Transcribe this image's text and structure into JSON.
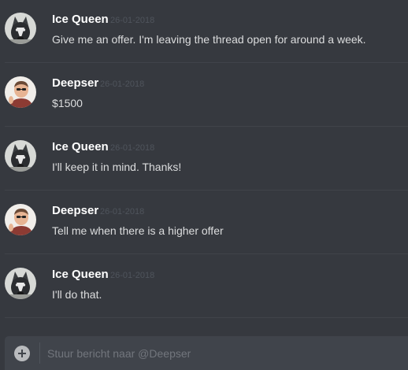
{
  "messages": [
    {
      "author": "Ice Queen",
      "timestamp": "26-01-2018",
      "text": "Give me an offer. I'm leaving the thread open for around a week.",
      "avatar": "husky-avatar"
    },
    {
      "author": "Deepser",
      "timestamp": "26-01-2018",
      "text": "$1500",
      "avatar": "person-avatar"
    },
    {
      "author": "Ice Queen",
      "timestamp": "26-01-2018",
      "text": "I'll keep it in mind. Thanks!",
      "avatar": "husky-avatar"
    },
    {
      "author": "Deepser",
      "timestamp": "26-01-2018",
      "text": "Tell me when there is a higher offer",
      "avatar": "person-avatar"
    },
    {
      "author": "Ice Queen",
      "timestamp": "26-01-2018",
      "text": "I'll do that.",
      "avatar": "husky-avatar"
    }
  ],
  "composer": {
    "placeholder": "Stuur bericht naar @Deepser",
    "value": ""
  },
  "colors": {
    "background": "#36393f",
    "composer": "#40444b",
    "username": "#ffffff",
    "message_text": "#dcddde",
    "timestamp": "#4f545c"
  }
}
